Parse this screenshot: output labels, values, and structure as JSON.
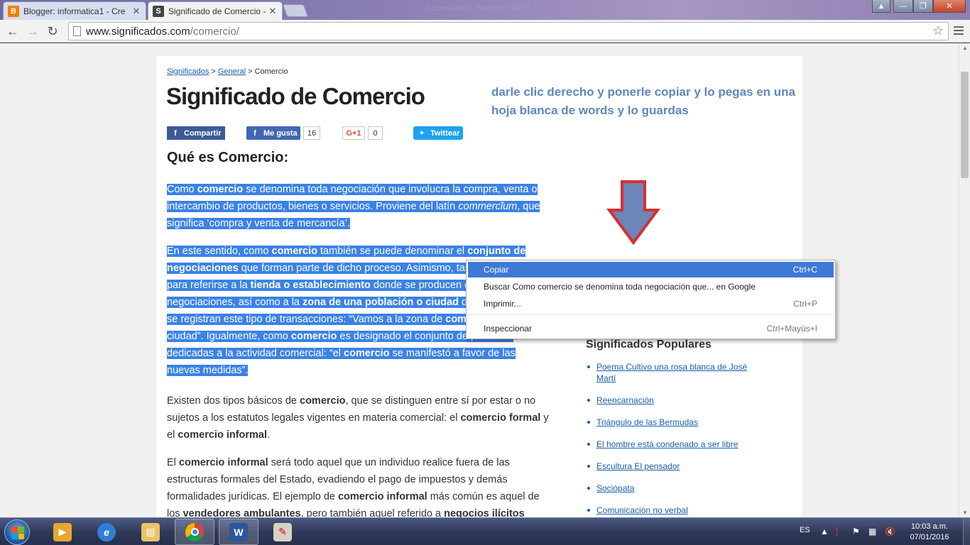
{
  "browser": {
    "tabs": [
      {
        "title": "Blogger: informatica1 - Cre",
        "favicon": "blogger-icon",
        "favicon_color": "#f57d00"
      },
      {
        "title": "Significado de Comercio -",
        "favicon": "significados-s-icon",
        "favicon_color": "#444444"
      }
    ],
    "background_window_title": "Documento1 - Microsoft Word",
    "url_host": "www.significados.com",
    "url_path": "/comercio/"
  },
  "page": {
    "breadcrumb": {
      "home": "Significados",
      "sep1": " > ",
      "category": "General",
      "sep2": " > ",
      "current": "Comercio"
    },
    "title": "Significado de Comercio",
    "annotation_note": "darle clic derecho y ponerle copiar y lo pegas en una hoja blanca de words y lo guardas",
    "share": {
      "facebook_share": "Compartir",
      "facebook_like": "Me gusta",
      "like_count": "16",
      "gplus_label": "G+1",
      "gplus_count": "0",
      "twitter": "Twittear"
    },
    "section_heading": "Qué es Comercio:",
    "paragraphs": {
      "p1": [
        {
          "t": "Como "
        },
        {
          "t": "comercio",
          "b": true
        },
        {
          "t": " se denomina toda negociación que involucra la compra, venta o intercambio de productos, bienes o servicios. Proviene del latín "
        },
        {
          "t": "commercĭum",
          "i": true
        },
        {
          "t": ", que significa ‘compra y venta de mercancía’."
        }
      ],
      "p2": [
        {
          "t": "En este sentido, como "
        },
        {
          "t": "comercio",
          "b": true
        },
        {
          "t": " también se puede denominar el "
        },
        {
          "t": "conjunto de negociaciones",
          "b": true
        },
        {
          "t": " que forman parte de dicho proceso. Asimismo, también se utiliza para referirse a la "
        },
        {
          "t": "tienda o establecimiento",
          "b": true
        },
        {
          "t": " donde se producen este tipo de negociaciones, así como a la "
        },
        {
          "t": "zona de una población o ciudad",
          "b": true
        },
        {
          "t": " donde mayormente se registran este tipo de transacciones: “Vamos a la zona de "
        },
        {
          "t": "comercio",
          "b": true
        },
        {
          "t": " de la ciudad”. Igualmente, como "
        },
        {
          "t": "comercio",
          "b": true
        },
        {
          "t": " es designado el conjunto de personas dedicadas a la actividad comercial: “el "
        },
        {
          "t": "comercio",
          "b": true
        },
        {
          "t": " se manifestó a favor de las nuevas medidas”."
        }
      ],
      "p3": [
        {
          "t": "Existen dos tipos básicos de "
        },
        {
          "t": "comercio",
          "b": true
        },
        {
          "t": ", que se distinguen entre sí por estar o no sujetos a los estatutos legales vigentes en materia comercial: el "
        },
        {
          "t": "comercio formal",
          "b": true
        },
        {
          "t": " y el "
        },
        {
          "t": "comercio informal",
          "b": true
        },
        {
          "t": "."
        }
      ],
      "p4": [
        {
          "t": "El "
        },
        {
          "t": "comercio informal",
          "b": true
        },
        {
          "t": " será todo aquel que un individuo realice fuera de las estructuras formales del Estado, evadiendo el pago de impuestos y demás formalidades jurídicas. El ejemplo de "
        },
        {
          "t": "comercio informal",
          "b": true
        },
        {
          "t": " más común es aquel de los "
        },
        {
          "t": "vendedores ambulantes",
          "b": true
        },
        {
          "t": ", pero también aquel referido a "
        },
        {
          "t": "negocios ilícitos",
          "b": true
        }
      ]
    },
    "popular": {
      "heading": "Significados Populares",
      "items": [
        "Poema Cultivo una rosa blanca de José Martí",
        "Reencarnación",
        "Triángulo de las Bermudas",
        "El hombre está condenado a ser libre",
        "Escultura El pensador",
        "Sociópata",
        "Comunicación no verbal"
      ]
    }
  },
  "context_menu": {
    "items": [
      {
        "label": "Copiar",
        "shortcut": "Ctrl+C",
        "highlighted": true
      },
      {
        "label": "Buscar Como comercio se denomina toda negociación que... en Google",
        "shortcut": ""
      },
      {
        "label": "Imprimir...",
        "shortcut": "Ctrl+P"
      },
      {
        "label": "Inspeccionar",
        "shortcut": "Ctrl+Mayús+I"
      }
    ]
  },
  "taskbar": {
    "apps": [
      "media-player-icon",
      "internet-explorer-icon",
      "file-explorer-icon",
      "chrome-icon",
      "word-icon",
      "paint-icon"
    ],
    "language": "ES",
    "time": "10:03 a.m.",
    "date": "07/01/2016"
  },
  "colors": {
    "selection": "#3b82e6",
    "link": "#1a5ea6",
    "note": "#5f87bd",
    "menu_highlight": "#3f79d6"
  }
}
